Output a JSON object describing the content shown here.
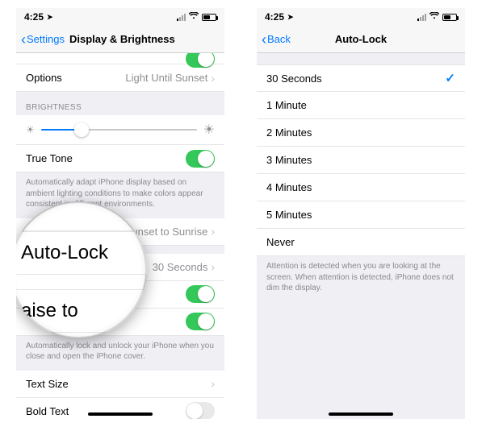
{
  "status": {
    "time": "4:25",
    "loc_glyph": "➤"
  },
  "left": {
    "back_label": "Settings",
    "title": "Display & Brightness",
    "options_label": "Options",
    "options_value": "Light Until Sunset",
    "brightness_header": "BRIGHTNESS",
    "true_tone_label": "True Tone",
    "true_tone_footer": "Automatically adapt iPhone display based on ambient lighting conditions to make colors appear consistent in different environments.",
    "night_shift_value": "Sunset to Sunrise",
    "auto_lock_label": "Auto-Lock",
    "auto_lock_value": "30 Seconds",
    "raise_partial": "aise to",
    "lock_footer": "Automatically lock and unlock your iPhone when you close and open the iPhone cover.",
    "text_size_label": "Text Size",
    "bold_text_label": "Bold Text"
  },
  "right": {
    "back_label": "Back",
    "title": "Auto-Lock",
    "options": [
      "30 Seconds",
      "1 Minute",
      "2 Minutes",
      "3 Minutes",
      "4 Minutes",
      "5 Minutes",
      "Never"
    ],
    "selected_index": 0,
    "footer": "Attention is detected when you are looking at the screen. When attention is detected, iPhone does not dim the display."
  },
  "lens": {
    "main_label": "Auto-Lock"
  }
}
